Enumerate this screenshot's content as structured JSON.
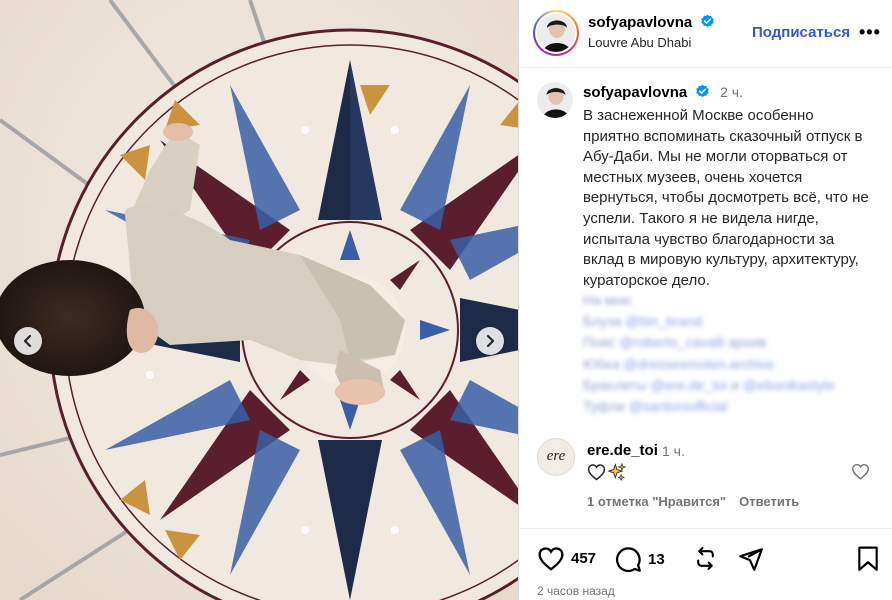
{
  "post": {
    "author": "sofyapavlovna",
    "location": "Louvre Abu Dhabi",
    "follow_label": "Подписаться",
    "more_label": "•••"
  },
  "caption": {
    "author": "sofyapavlovna",
    "time": "2 ч.",
    "text": "В заснеженной Москве особенно приятно вспоминать сказочный отпуск в Абу-Даби. Мы не могли оторваться от местных музеев, очень хочется вернуться, чтобы досмотреть всё, что не успели. Такого я не видела нигде, испытала чувство благодарности за вклад в мировую культуру, архитектуру, кураторское дело.",
    "credits": [
      {
        "label": "На мне:",
        "tag": ""
      },
      {
        "label": "Блуза ",
        "tag": "@bin_brand"
      },
      {
        "label": "Пояс ",
        "tag": "@roberto_cavalli",
        "suffix": " архив"
      },
      {
        "label": "Юбка ",
        "tag": "@dressesmoten.archive"
      },
      {
        "label": "Браслеты ",
        "tag": "@ere.de_toi",
        "suffix": " и ",
        "tag2": "@ebonikastyle"
      },
      {
        "label": "Туфли ",
        "tag": "@santoniofficial"
      }
    ]
  },
  "comment": {
    "avatar_text": "ere",
    "author": "ere.de_toi",
    "time": "1 ч.",
    "emoji": [
      "heart-outline",
      "sparkles"
    ],
    "likes_label": "1 отметка \"Нравится\"",
    "reply_label": "Ответить"
  },
  "actions": {
    "likes_count": "457",
    "comments_count": "13",
    "posted_ago": "2 часов назад"
  },
  "colors": {
    "accent": "#3a55c6",
    "verified": "#0095f6",
    "secondary_text": "#737373"
  }
}
